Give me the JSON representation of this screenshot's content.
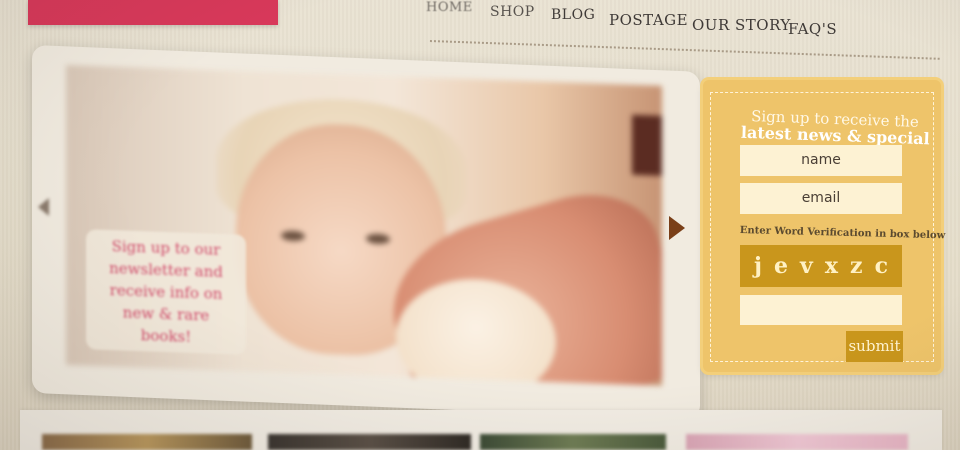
{
  "nav": {
    "items": [
      "HOME",
      "SHOP",
      "BLOG",
      "POSTAGE",
      "OUR STORY",
      "FAQ'S"
    ]
  },
  "hero": {
    "label_text": "Sign up to our newsletter and receive info on new & rare books!"
  },
  "signup": {
    "title_line1": "Sign up to receive the",
    "title_line2": "latest news & special offers",
    "name_placeholder": "name",
    "email_placeholder": "email",
    "verification_label": "Enter Word Verification in box below",
    "captcha_letters": [
      "j",
      "e",
      "v",
      "x",
      "z",
      "c"
    ],
    "submit_label": "submit"
  },
  "colors": {
    "accent_pink": "#d8385a",
    "signup_gold": "#eec46a",
    "button_gold": "#c9961c",
    "arrow_brown": "#7a3f18"
  }
}
